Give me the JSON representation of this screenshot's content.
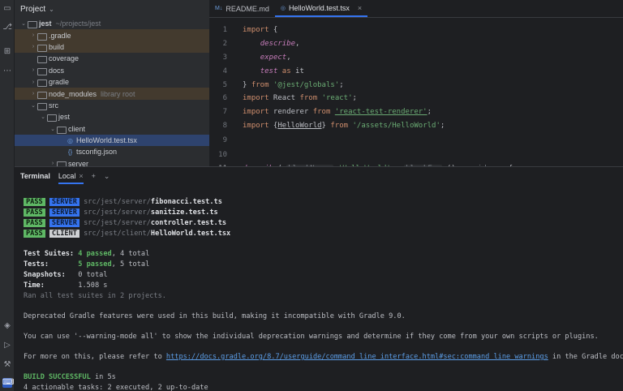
{
  "sidebar": {
    "title": "Project"
  },
  "tree": [
    {
      "name": "jest",
      "hint": "~/projects/jest",
      "type": "folder",
      "depth": 0,
      "open": true,
      "bold": true
    },
    {
      "name": ".gradle",
      "type": "folder",
      "depth": 1,
      "open": false,
      "excluded": true
    },
    {
      "name": "build",
      "type": "folder",
      "depth": 1,
      "open": false,
      "excluded": true
    },
    {
      "name": "coverage",
      "type": "folder",
      "depth": 1,
      "open": null
    },
    {
      "name": "docs",
      "type": "folder",
      "depth": 1,
      "open": false
    },
    {
      "name": "gradle",
      "type": "folder",
      "depth": 1,
      "open": false
    },
    {
      "name": "node_modules",
      "hint": "library root",
      "type": "folder",
      "depth": 1,
      "open": false,
      "excluded": true
    },
    {
      "name": "src",
      "type": "folder",
      "depth": 1,
      "open": true
    },
    {
      "name": "jest",
      "type": "folder",
      "depth": 2,
      "open": true
    },
    {
      "name": "client",
      "type": "folder",
      "depth": 3,
      "open": true
    },
    {
      "name": "HelloWorld.test.tsx",
      "type": "file",
      "depth": 4,
      "selected": true
    },
    {
      "name": "tsconfig.json",
      "type": "json",
      "depth": 4
    },
    {
      "name": "server",
      "type": "folder",
      "depth": 3,
      "open": false
    }
  ],
  "editor": {
    "tabs": [
      {
        "label": "README.md",
        "icon": "M↓",
        "active": false
      },
      {
        "label": "HelloWorld.test.tsx",
        "icon": "◎",
        "active": true
      }
    ],
    "lines": [
      {
        "n": "1",
        "html": "<span class=\"kw\">import</span> {"
      },
      {
        "n": "2",
        "html": "    <span class=\"it\">describe</span>,"
      },
      {
        "n": "3",
        "html": "    <span class=\"it\">expect</span>,"
      },
      {
        "n": "4",
        "html": "    <span class=\"it\">test</span> <span class=\"kw\">as</span> it"
      },
      {
        "n": "5",
        "html": "} <span class=\"kw\">from</span> <span class=\"str\">'@jest/globals'</span>;"
      },
      {
        "n": "6",
        "html": "<span class=\"kw\">import</span> React <span class=\"kw\">from</span> <span class=\"str\">'react'</span>;"
      },
      {
        "n": "7",
        "html": "<span class=\"kw\">import</span> renderer <span class=\"kw\">from</span> <span class=\"str ul\">'react-test-renderer'</span>;"
      },
      {
        "n": "8",
        "html": "<span class=\"kw\">import</span> {<span class=\"ul\">HelloWorld</span>} <span class=\"kw\">from</span> <span class=\"str\">'/assets/HelloWorld'</span>;"
      },
      {
        "n": "9",
        "html": ""
      },
      {
        "n": "10",
        "html": ""
      },
      {
        "n": "11",
        "html": "<span class=\"it\">describe</span>( <span class=\"ih\">blockName:</span> <span class=\"str\">'HelloWorld'</span>,  <span class=\"ih\">blockFn:</span> () <span class=\"dim\">: void</span>  => {"
      }
    ]
  },
  "terminal": {
    "title": "Terminal",
    "tab": "Local",
    "tests": [
      {
        "status": "PASS",
        "env": "SERVER",
        "dir": "src/jest/server/",
        "file": "fibonacci.test.ts"
      },
      {
        "status": "PASS",
        "env": "SERVER",
        "dir": "src/jest/server/",
        "file": "sanitize.test.ts"
      },
      {
        "status": "PASS",
        "env": "SERVER",
        "dir": "src/jest/server/",
        "file": "controller.test.ts"
      },
      {
        "status": "PASS",
        "env": "CLIENT",
        "dir": "src/jest/client/",
        "file": "HelloWorld.test.tsx"
      }
    ],
    "suites_label": "Test Suites:",
    "suites_passed": "4 passed",
    "suites_total": ", 4 total",
    "tests_label": "Tests:",
    "tests_passed": "5 passed",
    "tests_total": ", 5 total",
    "snap_label": "Snapshots:",
    "snap_val": "0 total",
    "time_label": "Time:",
    "time_val": "1.508 s",
    "ran": "Ran all test suites in 2 projects.",
    "dep": "Deprecated Gradle features were used in this build, making it incompatible with Gradle 9.0.",
    "warn": "You can use '--warning-mode all' to show the individual deprecation warnings and determine if they come from your own scripts or plugins.",
    "more_pre": "For more on this, please refer to ",
    "more_link": "https://docs.gradle.org/8.7/userguide/command_line_interface.html#sec:command_line_warnings",
    "more_post": " in the Gradle documentation.",
    "build": "BUILD SUCCESSFUL",
    "build_time": " in 5s",
    "tasks": "4 actionable tasks: 2 executed, 2 up-to-date"
  },
  "icons": [
    "folder-icon",
    "git-icon",
    "structure-icon",
    "more-icon",
    "services-icon",
    "run-icon",
    "build-icon",
    "terminal-icon"
  ]
}
